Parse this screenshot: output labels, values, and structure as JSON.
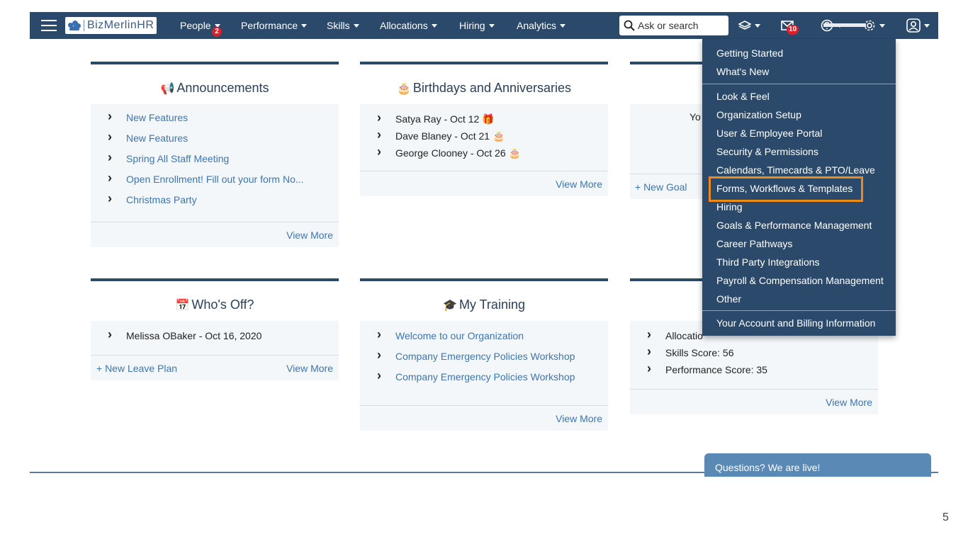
{
  "app": {
    "logo_text": "BizMerlinHR"
  },
  "nav": {
    "people": "People",
    "people_badge": "2",
    "performance": "Performance",
    "skills": "Skills",
    "allocations": "Allocations",
    "hiring": "Hiring",
    "analytics": "Analytics",
    "search_placeholder": "Ask or search",
    "messages_badge": "10"
  },
  "announcements": {
    "title": "Announcements",
    "items": [
      "New Features",
      "New Features",
      "Spring All Staff Meeting",
      "Open Enrollment! Fill out your form No...",
      "Christmas Party"
    ],
    "view_more": "View More"
  },
  "birthdays": {
    "title": "Birthdays and Anniversaries",
    "items": [
      "Satya Ray - Oct 12",
      "Dave Blaney - Oct 21",
      "George Clooney - Oct 26"
    ],
    "view_more": "View More"
  },
  "goals": {
    "partial_text": "Yo",
    "new_goal": "+ New Goal"
  },
  "whos_off": {
    "title": "Who's Off?",
    "items": [
      "Melissa OBaker - Oct 16, 2020"
    ],
    "new_leave_plan": "+ New Leave Plan",
    "view_more": "View More"
  },
  "training": {
    "title": "My Training",
    "items": [
      "Welcome to our Organization",
      "Company Emergency Policies Workshop",
      "Company Emergency Policies Workshop"
    ],
    "view_more": "View More"
  },
  "scores": {
    "items": [
      "Allocatio",
      "Skills Score: 56",
      "Performance Score: 35"
    ],
    "view_more": "View More"
  },
  "settings_menu": {
    "items": [
      "Getting Started",
      "What's New",
      "Look & Feel",
      "Organization Setup",
      "User & Employee Portal",
      "Security & Permissions",
      "Calendars, Timecards & PTO/Leave",
      "Forms, Workflows & Templates",
      "Hiring",
      "Goals & Performance Management",
      "Career Pathways",
      "Third Party Integrations",
      "Payroll & Compensation Management",
      "Other",
      "Your Account and Billing Information"
    ],
    "highlighted": "Forms, Workflows & Templates"
  },
  "chat": {
    "label": "Questions? We are live!"
  },
  "slide_number": "5",
  "colors": {
    "nav_bg": "#2b4a6b",
    "link": "#3d75b0",
    "highlight": "#f0881a",
    "badge": "#d6212b"
  }
}
